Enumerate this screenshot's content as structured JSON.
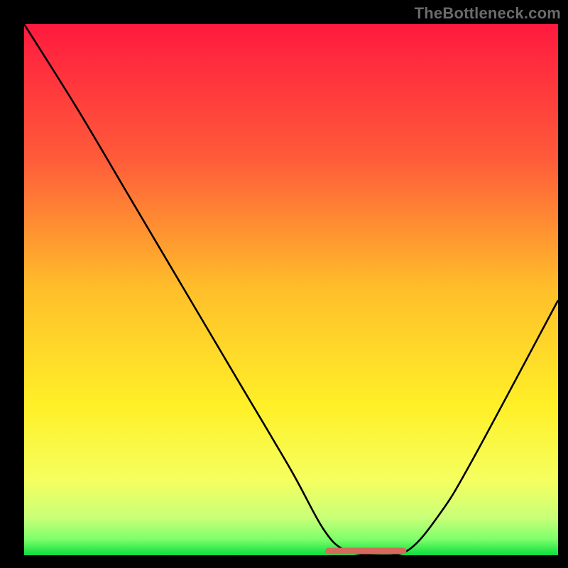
{
  "watermark": "TheBottleneck.com",
  "chart_data": {
    "type": "line",
    "title": "",
    "xlabel": "",
    "ylabel": "",
    "xlim": [
      0,
      100
    ],
    "ylim": [
      0,
      100
    ],
    "grid": false,
    "background_gradient": {
      "stops": [
        {
          "pos": 0.0,
          "color": "#ff1a3f"
        },
        {
          "pos": 0.25,
          "color": "#ff5a3a"
        },
        {
          "pos": 0.5,
          "color": "#ffbf2a"
        },
        {
          "pos": 0.72,
          "color": "#fff028"
        },
        {
          "pos": 0.86,
          "color": "#f5ff60"
        },
        {
          "pos": 0.93,
          "color": "#c8ff78"
        },
        {
          "pos": 0.97,
          "color": "#7dff6a"
        },
        {
          "pos": 1.0,
          "color": "#0cde3e"
        }
      ]
    },
    "series": [
      {
        "name": "bottleneck-curve",
        "color": "#000000",
        "x": [
          0,
          10,
          20,
          30,
          40,
          50,
          56,
          60,
          66,
          72,
          78,
          84,
          100
        ],
        "y": [
          100,
          84,
          67,
          50,
          33,
          16,
          5,
          1,
          0,
          1,
          8,
          18,
          48
        ]
      }
    ],
    "flat_segment": {
      "name": "optimal-range-marker",
      "color": "#d46a5c",
      "x_range": [
        57,
        71
      ],
      "y": 0
    }
  },
  "colors": {
    "frame": "#000000",
    "curve": "#000000",
    "flat_marker": "#d46a5c",
    "watermark": "#6a6a6a"
  }
}
